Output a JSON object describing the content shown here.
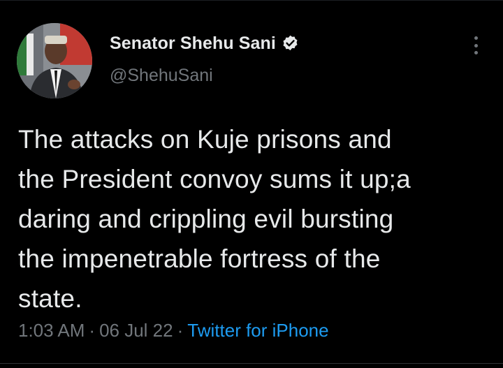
{
  "author": {
    "display_name": "Senator Shehu Sani",
    "handle": "@ShehuSani",
    "verified": true,
    "avatar_icon": "profile-photo"
  },
  "tweet": {
    "lines": [
      "The attacks on Kuje prisons and",
      "the President convoy sums it up;a",
      "daring and crippling evil bursting",
      "the impenetrable fortress of the",
      "state."
    ]
  },
  "meta": {
    "time": "1:03 AM",
    "separator": "·",
    "date": "06 Jul 22",
    "source": "Twitter for iPhone"
  },
  "colors": {
    "background": "#000000",
    "text": "#e7e9ea",
    "secondary_text": "#71767b",
    "link": "#1d9bf0"
  },
  "icons": {
    "verified": "verified-badge-icon",
    "more": "more-options-icon"
  }
}
